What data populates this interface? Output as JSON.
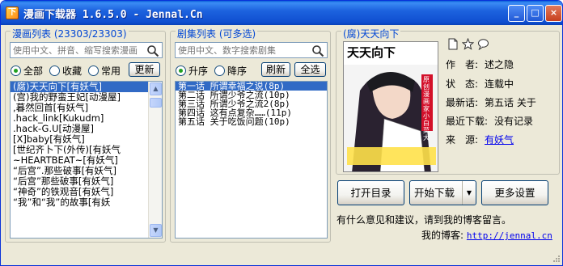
{
  "window": {
    "title": "漫画下载器 1.6.5.0 - Jennal.Cn",
    "app_icon": "下",
    "buttons": {
      "minimize": "_",
      "maximize": "□",
      "close": "×"
    }
  },
  "comic_panel": {
    "title": "漫画列表 (23303/23303)",
    "search_placeholder": "使用中文、拼音、缩写搜索漫画",
    "filters": [
      {
        "label": "全部",
        "selected": true
      },
      {
        "label": "收藏",
        "selected": false
      },
      {
        "label": "常用",
        "selected": false
      }
    ],
    "update_button": "更新",
    "items": [
      "(腐)天天向下[有妖气]",
      "(宫)我的野蛮王妃[动漫屋]",
      ",暮然回首[有妖气]",
      ".hack_link[Kukudm]",
      ".hack-G.U[动漫屋]",
      "[X]baby[有妖气]",
      "[世纪齐卜下(外传)[有妖气",
      "~HEARTBEAT~[有妖气]",
      "“后宫”.那些破事[有妖气]",
      "“后宫”那些破事[有妖气]",
      "“神奇”的铁观音[有妖气]",
      "“我”和“我”的故事[有妖"
    ],
    "selected_index": 0
  },
  "episode_panel": {
    "title": "剧集列表 (可多选)",
    "search_placeholder": "使用中文、数字搜索剧集",
    "sort": [
      {
        "label": "升序",
        "selected": true
      },
      {
        "label": "降序",
        "selected": false
      }
    ],
    "refresh_button": "刷新",
    "select_all_button": "全选",
    "items": [
      "第一话 所谓幸福之说(8p)",
      "第二话 所谓少爷之流(10p)",
      "第三话 所谓少爷之流2(8p)",
      "第四话 这有点复杂……(11p)",
      "第五话 关于吃饭问题(10p)"
    ],
    "selected_index": 0
  },
  "detail_panel": {
    "title": "(腐)天天向下",
    "cover_title": "天天向下",
    "cover_author": "原创漫画家小白菜大",
    "icons": [
      "document-icon",
      "star-icon",
      "comment-icon"
    ],
    "author_label": "作　者:",
    "author": "述之隐",
    "status_label": "状　态:",
    "status": "连载中",
    "latest_label": "最新话:",
    "latest": "第五话 关于",
    "recent_label": "最近下载:",
    "recent": "没有记录",
    "source_label": "来　源:",
    "source": "有妖气"
  },
  "actions": {
    "open_dir": "打开目录",
    "start_download": "开始下载",
    "more_settings": "更多设置"
  },
  "footer": {
    "feedback": "有什么意见和建议，请到我的博客留言。",
    "blog_label": "我的博客:",
    "blog_url": "http://jennal.cn"
  }
}
